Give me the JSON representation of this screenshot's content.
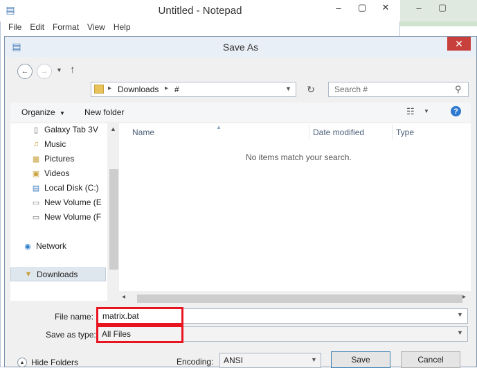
{
  "notepad": {
    "title": "Untitled - Notepad",
    "menu": [
      "File",
      "Edit",
      "Format",
      "View",
      "Help"
    ]
  },
  "dialog": {
    "title": "Save As",
    "breadcrumb": [
      "Downloads",
      "#"
    ],
    "search_placeholder": "Search #",
    "toolbar": {
      "organize": "Organize",
      "new_folder": "New folder"
    },
    "nav_items": [
      {
        "label": "Galaxy Tab 3V",
        "icon": "device-icon"
      },
      {
        "label": "Music",
        "icon": "music-folder-icon"
      },
      {
        "label": "Pictures",
        "icon": "pictures-folder-icon"
      },
      {
        "label": "Videos",
        "icon": "videos-folder-icon"
      },
      {
        "label": "Local Disk (C:)",
        "icon": "local-disk-icon"
      },
      {
        "label": "New Volume (E",
        "icon": "drive-icon"
      },
      {
        "label": "New Volume (F",
        "icon": "drive-icon"
      },
      {
        "label": "Network",
        "icon": "network-icon"
      },
      {
        "label": "Downloads",
        "icon": "downloads-folder-icon"
      }
    ],
    "columns": [
      "Name",
      "Date modified",
      "Type"
    ],
    "empty_message": "No items match your search.",
    "file_name_label": "File name:",
    "file_name_value": "matrix.bat",
    "save_type_label": "Save as type:",
    "save_type_value": "All Files",
    "hide_folders": "Hide Folders",
    "encoding_label": "Encoding:",
    "encoding_value": "ANSI",
    "save_button": "Save",
    "cancel_button": "Cancel"
  },
  "colors": {
    "highlight_box": "#e8141f",
    "close_button": "#c7403b"
  }
}
